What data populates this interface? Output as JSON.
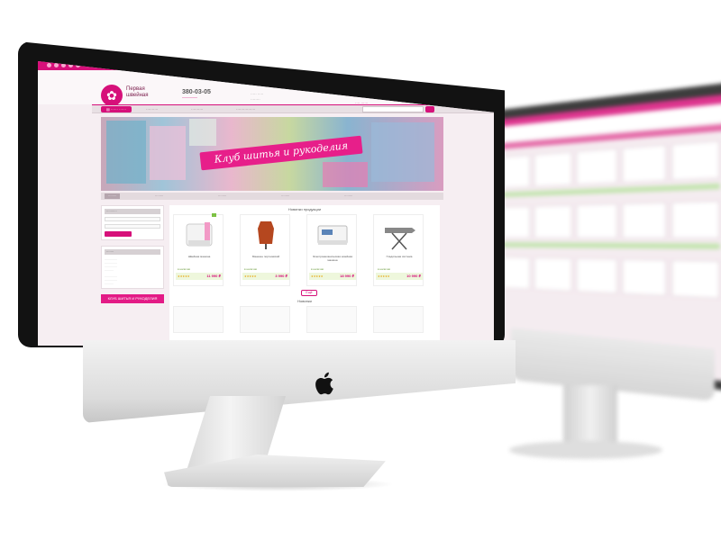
{
  "site": {
    "logo_text": "Первая швейная",
    "phone": "380-03-05",
    "banner_title": "Клуб шитья и рукоделия",
    "section_popular": "Новинки продукции",
    "section_new": "Новинки",
    "more_label": "Ещё",
    "side_promo": "КЛУБ ШИТЬЯ И РУКОДЕЛИЯ",
    "products": [
      {
        "name": "Швейная машина",
        "price": "11 990 ₽",
        "avail": "в наличии"
      },
      {
        "name": "Манекен портновский",
        "price": "3 990 ₽",
        "avail": "в наличии"
      },
      {
        "name": "Электромеханическая швейная машина",
        "price": "18 990 ₽",
        "avail": "в наличии"
      },
      {
        "name": "Гладильная система",
        "price": "10 990 ₽",
        "avail": "в наличии"
      }
    ]
  },
  "colors": {
    "brand": "#d6107a",
    "bezel": "#121212",
    "price_bar": "#eef7dc"
  },
  "icons": [
    "apple-logo-icon"
  ]
}
